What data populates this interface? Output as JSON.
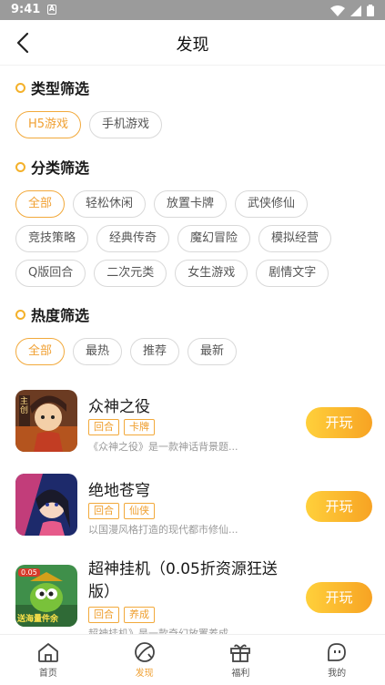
{
  "status_bar": {
    "time": "9:41",
    "notification_icon": "A"
  },
  "header": {
    "title": "发现"
  },
  "sections": {
    "type_filter": {
      "title": "类型筛选",
      "chips": [
        "H5游戏",
        "手机游戏"
      ],
      "selected": "H5游戏"
    },
    "category_filter": {
      "title": "分类筛选",
      "rows": [
        [
          "全部",
          "轻松休闲",
          "放置卡牌",
          "武侠修仙"
        ],
        [
          "竞技策略",
          "经典传奇",
          "魔幻冒险",
          "模拟经营"
        ],
        [
          "Q版回合",
          "二次元类",
          "女生游戏",
          "剧情文字"
        ]
      ],
      "selected": "全部"
    },
    "heat_filter": {
      "title": "热度筛选",
      "chips": [
        "全部",
        "最热",
        "推荐",
        "最新"
      ],
      "selected": "全部"
    }
  },
  "games": [
    {
      "name": "众神之役",
      "tags": [
        "回合",
        "卡牌"
      ],
      "desc": "《众神之役》是一款神话背景题...",
      "button": "开玩",
      "icon_text": "主创"
    },
    {
      "name": "绝地苍穹",
      "tags": [
        "回合",
        "仙侠"
      ],
      "desc": "以国漫风格打造的现代都市修仙...",
      "button": "开玩"
    },
    {
      "name": "超神挂机（0.05折资源狂送",
      "name_line2": "版）",
      "tags": [
        "回合",
        "养成"
      ],
      "desc": "超神挂机》是一款奇幻放置养成...",
      "button": "开玩",
      "icon_badge": "0.05",
      "icon_text": "送海量件余"
    }
  ],
  "tabbar": {
    "items": [
      {
        "label": "首页",
        "icon": "home-icon"
      },
      {
        "label": "发现",
        "icon": "discover-icon"
      },
      {
        "label": "福利",
        "icon": "gift-icon"
      },
      {
        "label": "我的",
        "icon": "profile-icon"
      }
    ],
    "active": "发现"
  },
  "colors": {
    "accent": "#f0a032",
    "button_start": "#ffd03b",
    "button_end": "#f7a323",
    "status_bar": "#9b9b9b"
  }
}
